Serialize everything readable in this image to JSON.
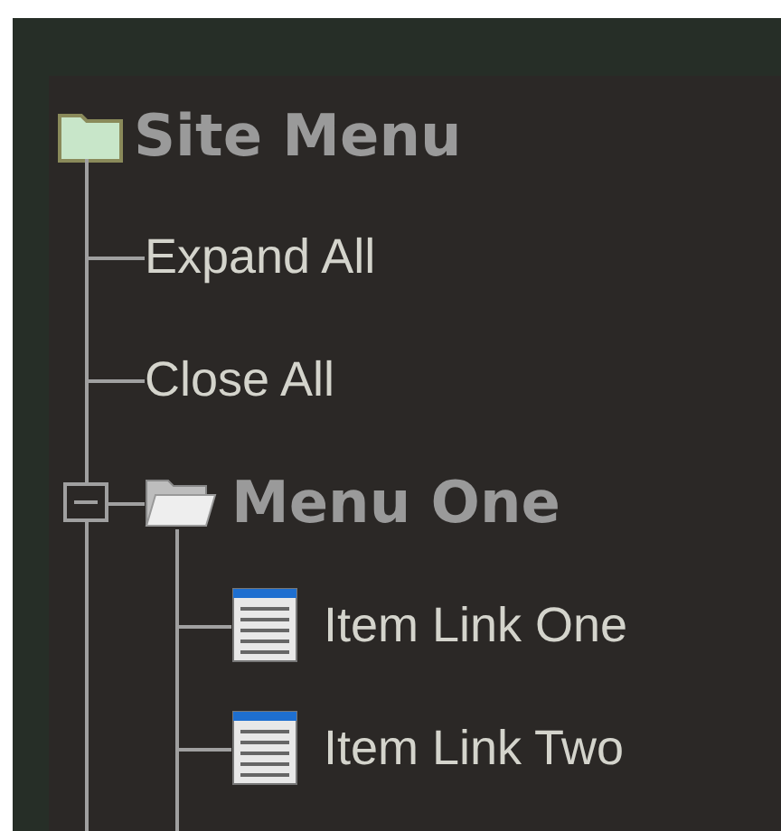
{
  "tree": {
    "label": "Site Menu",
    "kind": "root",
    "children": [
      {
        "label": "Expand All",
        "kind": "action"
      },
      {
        "label": "Close All",
        "kind": "action"
      },
      {
        "label": "Menu One",
        "kind": "folder",
        "expanded": true,
        "children": [
          {
            "label": "Item Link One",
            "kind": "page"
          },
          {
            "label": "Item Link Two",
            "kind": "page"
          }
        ]
      }
    ]
  }
}
